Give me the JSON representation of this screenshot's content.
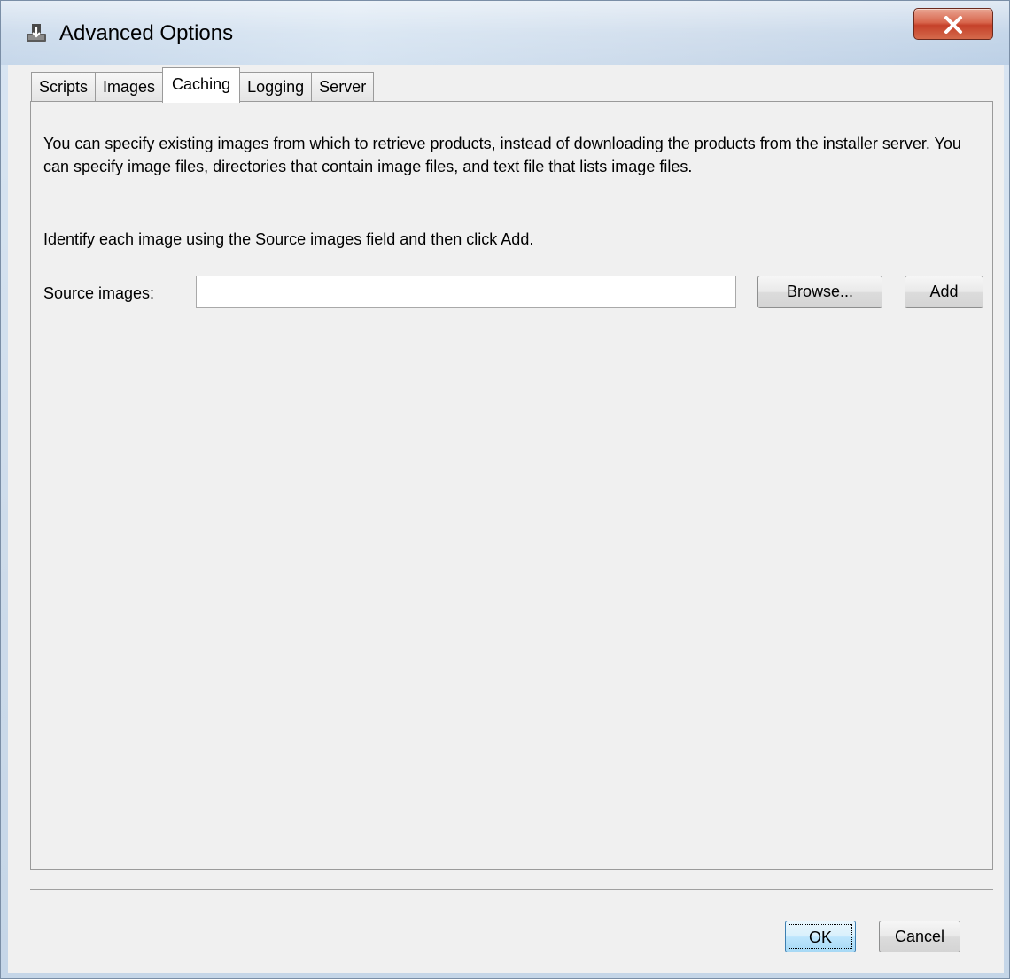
{
  "window": {
    "title": "Advanced Options",
    "icon": "installer-icon",
    "close_icon": "close-icon"
  },
  "tabs": [
    {
      "label": "Scripts",
      "active": false
    },
    {
      "label": "Images",
      "active": false
    },
    {
      "label": "Caching",
      "active": true
    },
    {
      "label": "Logging",
      "active": false
    },
    {
      "label": "Server",
      "active": false
    }
  ],
  "caching": {
    "description": "You can specify existing images from which to retrieve products, instead of downloading the products from the installer server. You can specify image files, directories that contain image files, and text file that lists image files.",
    "instruction": "Identify each image using the Source images field and then click Add.",
    "source_label": "Source images:",
    "source_value": "",
    "browse_label": "Browse...",
    "add_label": "Add"
  },
  "footer": {
    "ok_label": "OK",
    "cancel_label": "Cancel"
  },
  "colors": {
    "titlebar": "#cddbea",
    "close_button": "#c5412a",
    "dialog_background": "#f0f0f0",
    "default_button": "#bee6fd"
  }
}
